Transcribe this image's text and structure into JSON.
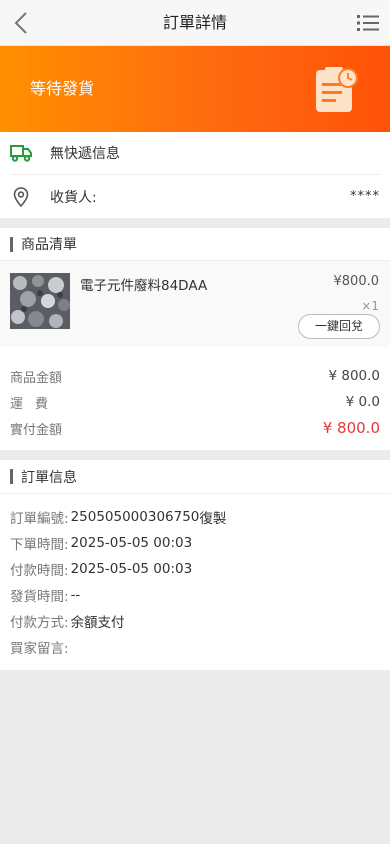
{
  "header": {
    "title": "訂單詳情",
    "back_icon": "chevron-left-icon",
    "menu_icon": "list-menu-icon"
  },
  "status": {
    "text": "等待發貨",
    "icon": "clipboard-clock-icon"
  },
  "address": {
    "express_text": "無快遞信息",
    "receiver_label": "收貨人:",
    "receiver_value": "****"
  },
  "goods": {
    "section_title": "商品清單",
    "item": {
      "name": "電子元件廢料84DAA",
      "price": "¥800.0",
      "qty": "×1",
      "button_label": "一鍵回兌"
    },
    "summary": {
      "goods_amount_label": "商品金額",
      "goods_amount_value": "¥ 800.0",
      "shipping_label": "運費",
      "shipping_value": "¥ 0.0",
      "paid_label": "實付金額",
      "paid_value": "¥ 800.0"
    }
  },
  "order_info": {
    "section_title": "訂單信息",
    "rows": [
      {
        "label": "訂單編號:",
        "value": "250505000306750",
        "action": "復製"
      },
      {
        "label": "下單時間:",
        "value": "2025-05-05 00:03"
      },
      {
        "label": "付款時間:",
        "value": "2025-05-05 00:03"
      },
      {
        "label": "發貨時間:",
        "value": "--"
      },
      {
        "label": "付款方式:",
        "value": "余額支付"
      },
      {
        "label": "買家留言:",
        "value": ""
      }
    ]
  },
  "colors": {
    "accent_orange": "#ff6a10",
    "price_red": "#e23a3a"
  }
}
